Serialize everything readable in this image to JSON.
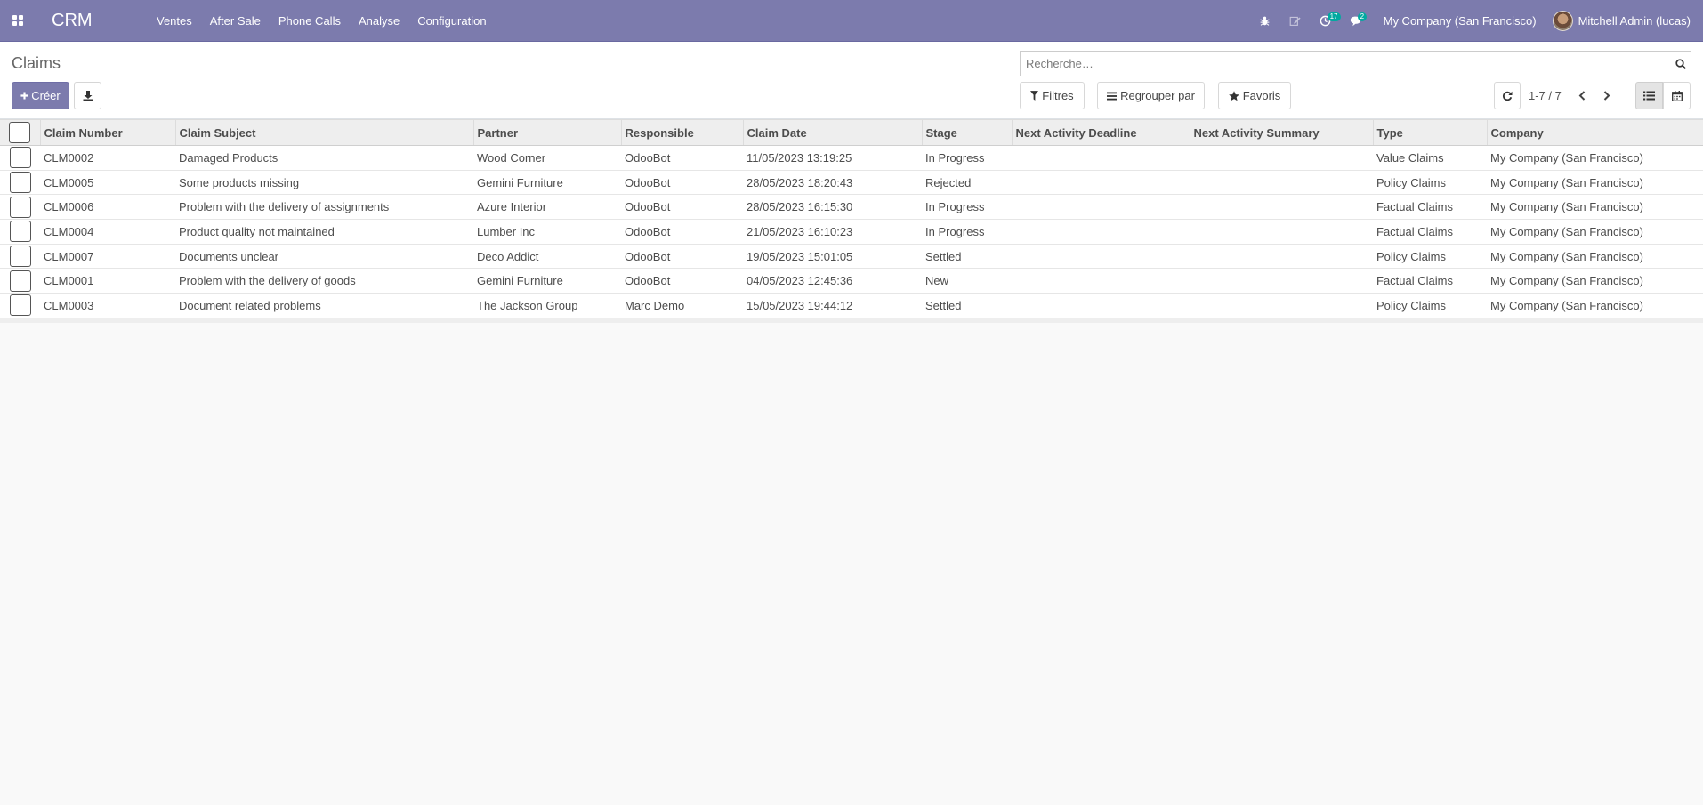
{
  "navbar": {
    "brand": "CRM",
    "menu": [
      "Ventes",
      "After Sale",
      "Phone Calls",
      "Analyse",
      "Configuration"
    ],
    "activity_count": "17",
    "message_count": "2",
    "company": "My Company (San Francisco)",
    "user": "Mitchell Admin (lucas)",
    "icons": [
      "apps-icon",
      "bug-icon",
      "edit-icon",
      "clock-icon",
      "chat-icon"
    ],
    "accent_color": "#7c7bad"
  },
  "control_panel": {
    "breadcrumb": "Claims",
    "create_label": "Créer",
    "search_placeholder": "Recherche…",
    "filters_label": "Filtres",
    "group_by_label": "Regrouper par",
    "favorites_label": "Favoris",
    "pager": "1-7 / 7"
  },
  "table": {
    "columns": [
      "Claim Number",
      "Claim Subject",
      "Partner",
      "Responsible",
      "Claim Date",
      "Stage",
      "Next Activity Deadline",
      "Next Activity Summary",
      "Type",
      "Company"
    ],
    "rows": [
      [
        "CLM0002",
        "Damaged Products",
        "Wood Corner",
        "OdooBot",
        "11/05/2023 13:19:25",
        "In Progress",
        "",
        "",
        "Value Claims",
        "My Company (San Francisco)"
      ],
      [
        "CLM0005",
        "Some products missing",
        "Gemini Furniture",
        "OdooBot",
        "28/05/2023 18:20:43",
        "Rejected",
        "",
        "",
        "Policy Claims",
        "My Company (San Francisco)"
      ],
      [
        "CLM0006",
        "Problem with the delivery of assignments",
        "Azure Interior",
        "OdooBot",
        "28/05/2023 16:15:30",
        "In Progress",
        "",
        "",
        "Factual Claims",
        "My Company (San Francisco)"
      ],
      [
        "CLM0004",
        "Product quality not maintained",
        "Lumber Inc",
        "OdooBot",
        "21/05/2023 16:10:23",
        "In Progress",
        "",
        "",
        "Factual Claims",
        "My Company (San Francisco)"
      ],
      [
        "CLM0007",
        "Documents unclear",
        "Deco Addict",
        "OdooBot",
        "19/05/2023 15:01:05",
        "Settled",
        "",
        "",
        "Policy Claims",
        "My Company (San Francisco)"
      ],
      [
        "CLM0001",
        "Problem with the delivery of goods",
        "Gemini Furniture",
        "OdooBot",
        "04/05/2023 12:45:36",
        "New",
        "",
        "",
        "Factual Claims",
        "My Company (San Francisco)"
      ],
      [
        "CLM0003",
        "Document related problems",
        "The Jackson Group",
        "Marc Demo",
        "15/05/2023 19:44:12",
        "Settled",
        "",
        "",
        "Policy Claims",
        "My Company (San Francisco)"
      ]
    ]
  }
}
